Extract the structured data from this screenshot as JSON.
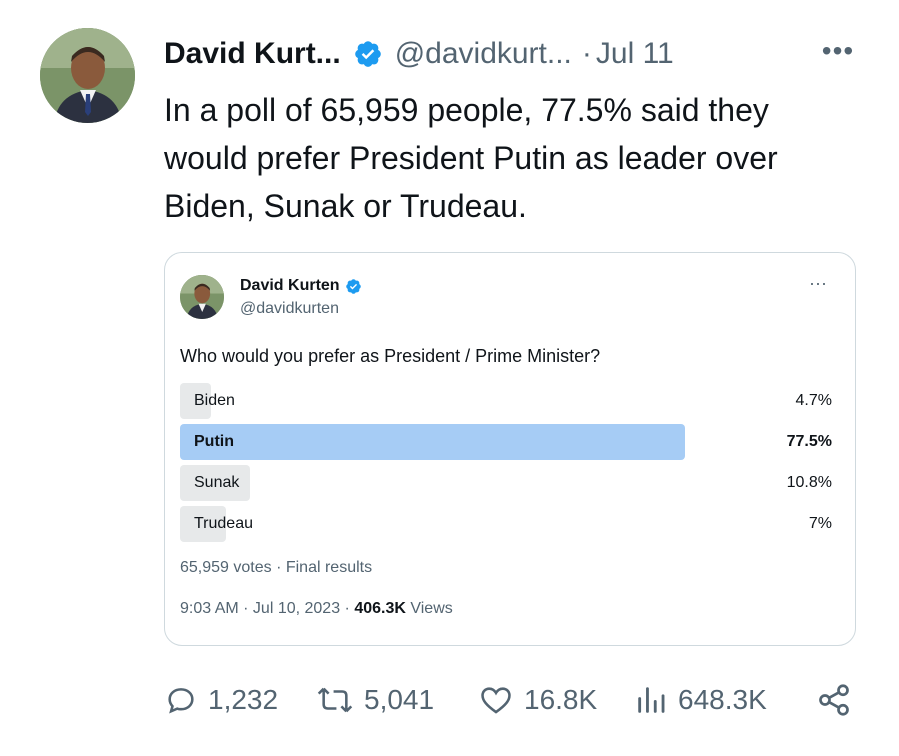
{
  "tweet": {
    "author_name": "David Kurt...",
    "handle": "@davidkurt...",
    "separator": "·",
    "date": "Jul 11",
    "more": "•••",
    "text_lines": [
      "In a poll of 65,959 people, 77.5% said they",
      "would prefer President Putin as leader over",
      "Biden, Sunak or Trudeau."
    ]
  },
  "quoted": {
    "author_name": "David Kurten",
    "handle": "@davidkurten",
    "more": "···",
    "question": "Who would you prefer as President / Prime Minister?",
    "options": [
      {
        "label": "Biden",
        "percent": "4.7%",
        "share": 4.7,
        "winner": false
      },
      {
        "label": "Putin",
        "percent": "77.5%",
        "share": 77.5,
        "winner": true
      },
      {
        "label": "Sunak",
        "percent": "10.8%",
        "share": 10.8,
        "winner": false
      },
      {
        "label": "Trudeau",
        "percent": "7%",
        "share": 7,
        "winner": false
      }
    ],
    "meta": "65,959 votes · Final results",
    "time": "9:03 AM · Jul 10, 2023 · ",
    "views_count": "406.3K",
    "views_label": " Views"
  },
  "actions": {
    "replies": "1,232",
    "reposts": "5,041",
    "likes": "16.8K",
    "views": "648.3K"
  },
  "colors": {
    "verified": "#1d9bf0",
    "winner_bar": "#a6ccf5",
    "bar": "#e7e9ea"
  },
  "icons": [
    "verified-badge-icon",
    "more-icon",
    "reply-icon",
    "repost-icon",
    "like-icon",
    "views-icon",
    "share-icon"
  ]
}
